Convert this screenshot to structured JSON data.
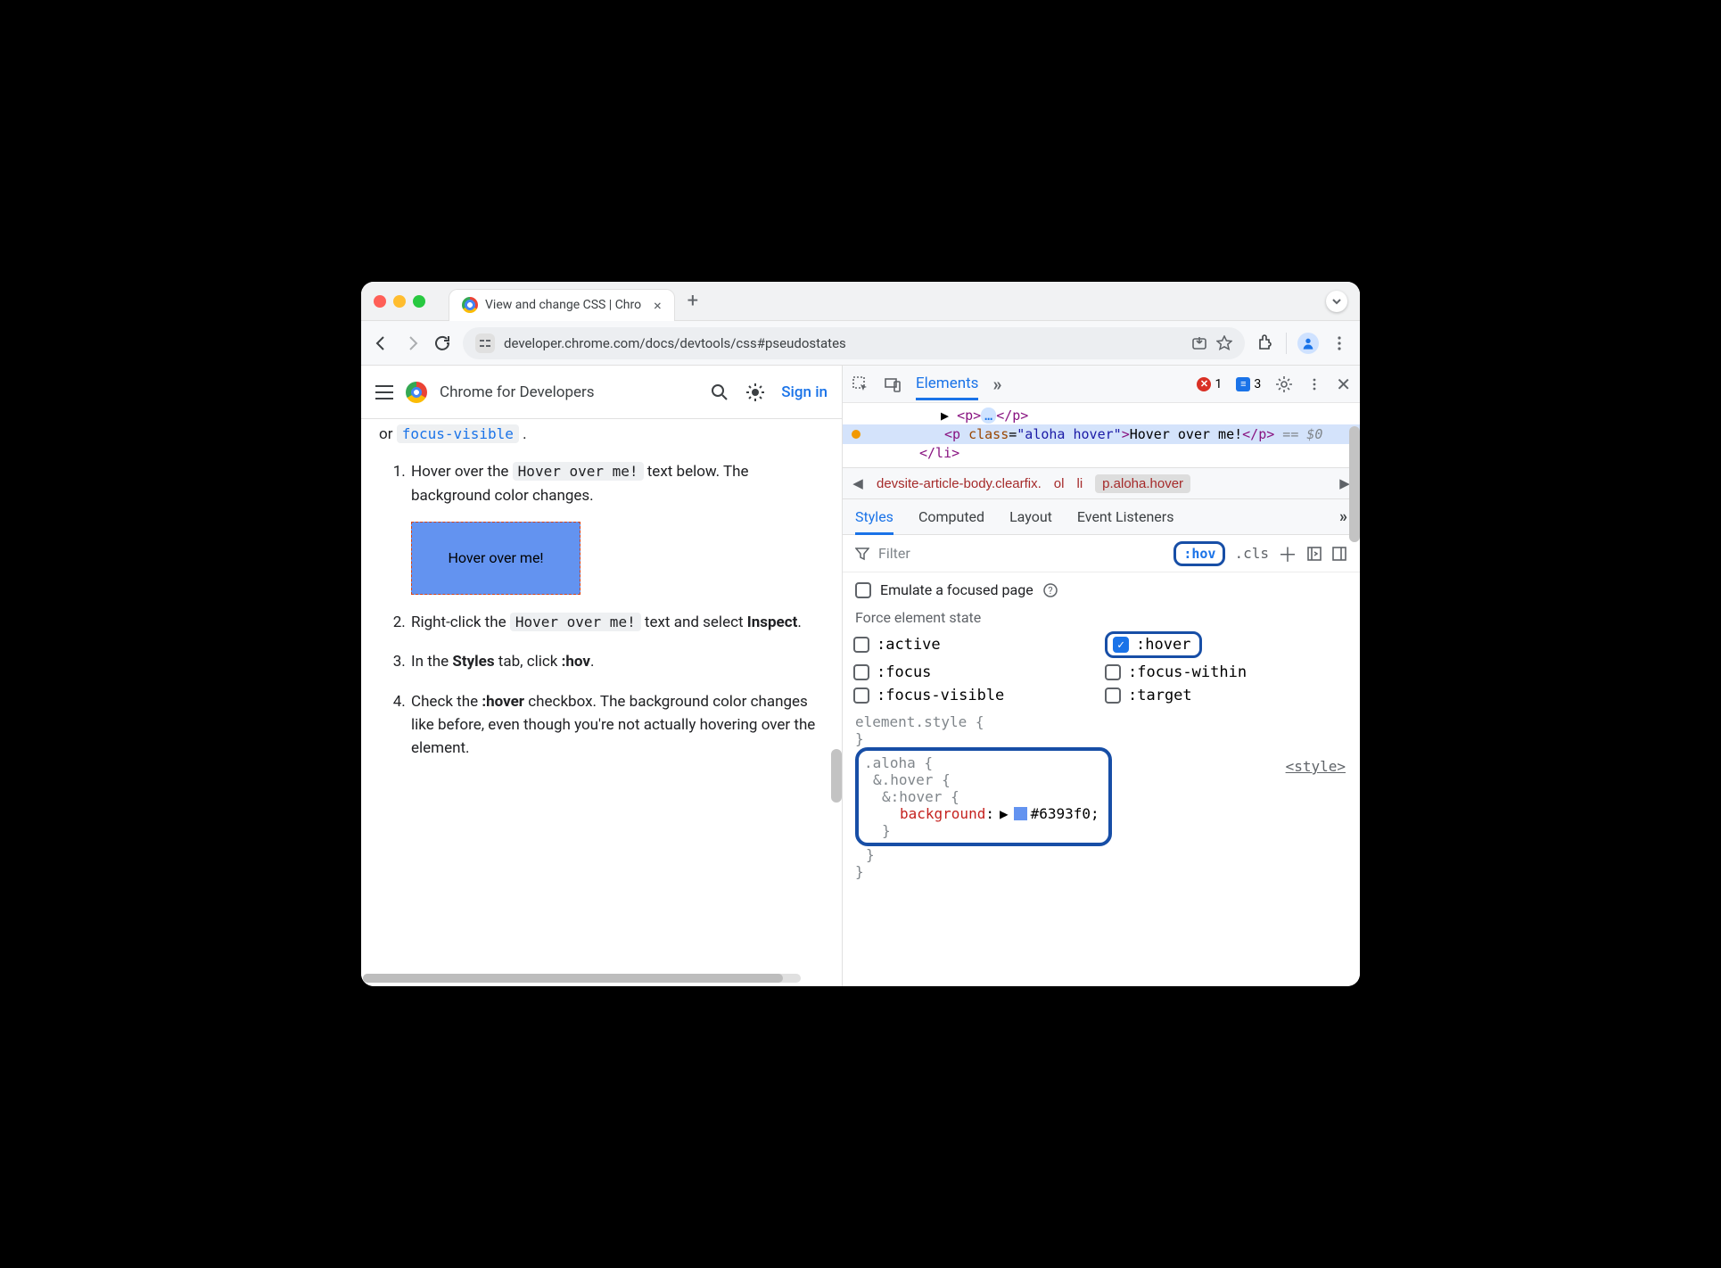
{
  "browser": {
    "tab_title": "View and change CSS  |  Chro",
    "url": "developer.chrome.com/docs/devtools/css#pseudostates",
    "new_tab_plus": "+",
    "close_tab": "×"
  },
  "page": {
    "site_title": "Chrome for Developers",
    "sign_in": "Sign in",
    "intro_or": "or ",
    "intro_code": "focus-visible",
    "steps": {
      "s1_a": "Hover over the ",
      "s1_code": "Hover over me!",
      "s1_b": " text below. The background color changes.",
      "hover_box": "Hover over me!",
      "s2_a": "Right-click the ",
      "s2_code": "Hover over me!",
      "s2_b": " text and select ",
      "s2_inspect": "Inspect",
      "s3_a": "In the ",
      "s3_styles": "Styles",
      "s3_b": " tab, click ",
      "s3_hov": ":hov",
      "s4_a": "Check the ",
      "s4_hover": ":hover",
      "s4_b": " checkbox. The background color changes like before, even though you're not actually hovering over the element."
    }
  },
  "devtools": {
    "top": {
      "elements": "Elements",
      "more": "»",
      "errors": "1",
      "info": "3"
    },
    "dom": {
      "row1_pre": "▶ ",
      "row1_open": "<p>",
      "row1_dots": "…",
      "row1_close": "</p>",
      "sel_open": "<p class=\"aloha hover\">",
      "sel_text": "Hover over me!",
      "row3_close": "</p>",
      "row3_eq": " == ",
      "row3_dollar": "$0",
      "row4": "</li>"
    },
    "breadcrumbs": [
      "devsite-article-body.clearfix.",
      "ol",
      "li",
      "p.aloha.hover"
    ],
    "style_tabs": {
      "styles": "Styles",
      "computed": "Computed",
      "layout": "Layout",
      "events": "Event Listeners",
      "more": "»"
    },
    "filter": {
      "label": "Filter",
      "hov": ":hov",
      "cls": ".cls",
      "plus": "+"
    },
    "emulate": "Emulate a focused page",
    "force_title": "Force element state",
    "states": {
      "active": ":active",
      "hover": ":hover",
      "focus": ":focus",
      "focus_within": ":focus-within",
      "focus_visible": ":focus-visible",
      "target": ":target"
    },
    "rules": {
      "element_style": "element.style {",
      "close": "}",
      "aloha": ".aloha {",
      "hover_nest": "&.hover {",
      "pseudo": "&:hover {",
      "prop": "background",
      "hex": "#6393f0;",
      "source": "<style>"
    },
    "colors": {
      "accent": "#1a73e8",
      "ring": "#174ea6",
      "swatch": "#6393f0"
    }
  }
}
